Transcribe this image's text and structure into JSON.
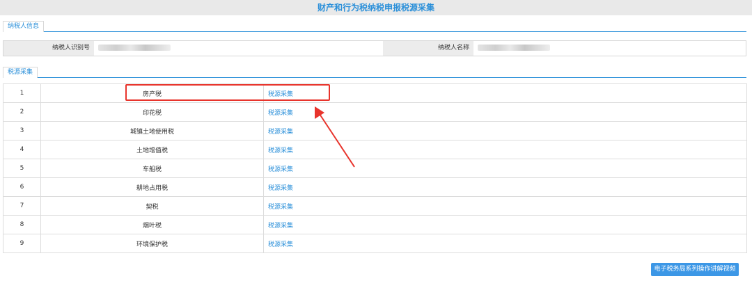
{
  "page": {
    "title": "财产和行为税纳税申报税源采集",
    "accent_color": "#2a8fd9",
    "highlight_color": "#e8342c"
  },
  "taxpayer_section": {
    "tab_label": "纳税人信息",
    "id_label": "纳税人识别号",
    "name_label": "纳税人名称"
  },
  "source_section": {
    "tab_label": "税源采集",
    "rows": [
      {
        "no": "1",
        "name": "房产税",
        "action": "税源采集"
      },
      {
        "no": "2",
        "name": "印花税",
        "action": "税源采集"
      },
      {
        "no": "3",
        "name": "城镇土地使用税",
        "action": "税源采集"
      },
      {
        "no": "4",
        "name": "土地增值税",
        "action": "税源采集"
      },
      {
        "no": "5",
        "name": "车船税",
        "action": "税源采集"
      },
      {
        "no": "6",
        "name": "耕地占用税",
        "action": "税源采集"
      },
      {
        "no": "7",
        "name": "契税",
        "action": "税源采集"
      },
      {
        "no": "8",
        "name": "烟叶税",
        "action": "税源采集"
      },
      {
        "no": "9",
        "name": "环境保护税",
        "action": "税源采集"
      }
    ]
  },
  "footer": {
    "video_button_label": "电子税务局系列操作讲解视频"
  }
}
